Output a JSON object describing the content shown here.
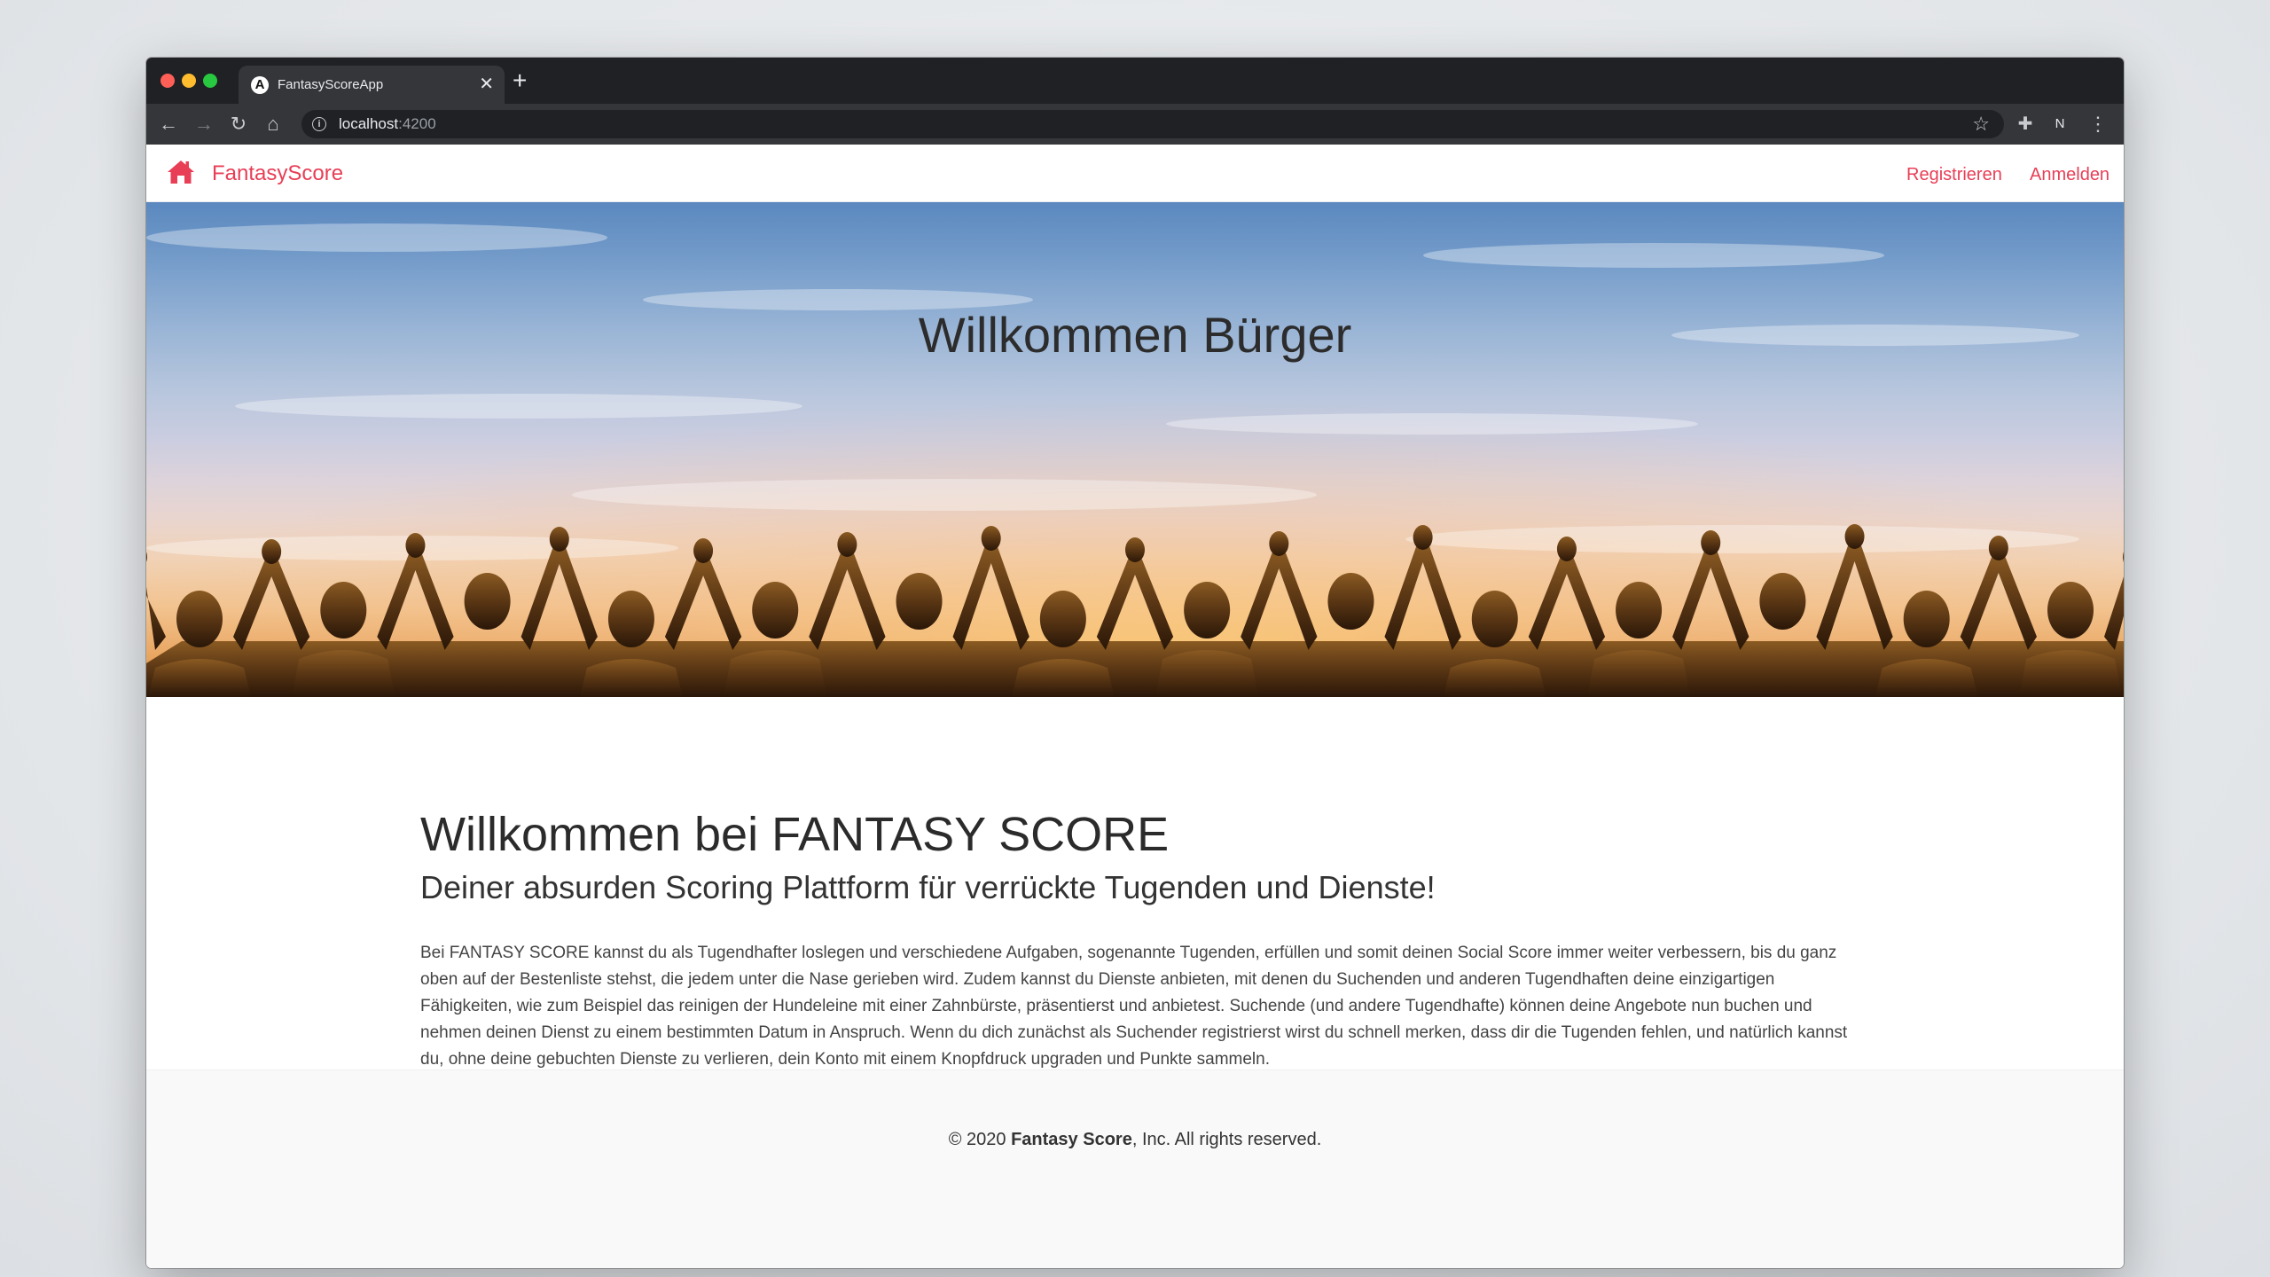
{
  "browser": {
    "tab_title": "FantasyScoreApp",
    "tab_favicon_letter": "A",
    "url_host": "localhost",
    "url_port": ":4200",
    "profile_letter": "N"
  },
  "navbar": {
    "brand": "FantasyScore",
    "links": [
      "Registrieren",
      "Anmelden"
    ],
    "accent_color": "#e83e56"
  },
  "hero": {
    "title": "Willkommen Bürger"
  },
  "main": {
    "heading": "Willkommen bei FANTASY SCORE",
    "subheading": "Deiner absurden Scoring Plattform für verrückte Tugenden und Dienste!",
    "paragraph": "Bei FANTASY SCORE kannst du als Tugendhafter loslegen und verschiedene Aufgaben, sogenannte Tugenden, erfüllen und somit deinen Social Score immer weiter verbessern, bis du ganz oben auf der Bestenliste stehst, die jedem unter die Nase gerieben wird. Zudem kannst du Dienste anbieten, mit denen du Suchenden und anderen Tugendhaften deine einzigartigen Fähigkeiten, wie zum Beispiel das reinigen der Hundeleine mit einer Zahnbürste, präsentierst und anbietest. Suchende (und andere Tugendhafte) können deine Angebote nun buchen und nehmen deinen Dienst zu einem bestimmten Datum in Anspruch. Wenn du dich zunächst als Suchender registrierst wirst du schnell merken, dass dir die Tugenden fehlen, und natürlich kannst du, ohne deine gebuchten Dienste zu verlieren, dein Konto mit einem Knopfdruck upgraden und Punkte sammeln."
  },
  "footer": {
    "prefix": "© 2020 ",
    "company": "Fantasy Score",
    "suffix": ", Inc. All rights reserved."
  }
}
